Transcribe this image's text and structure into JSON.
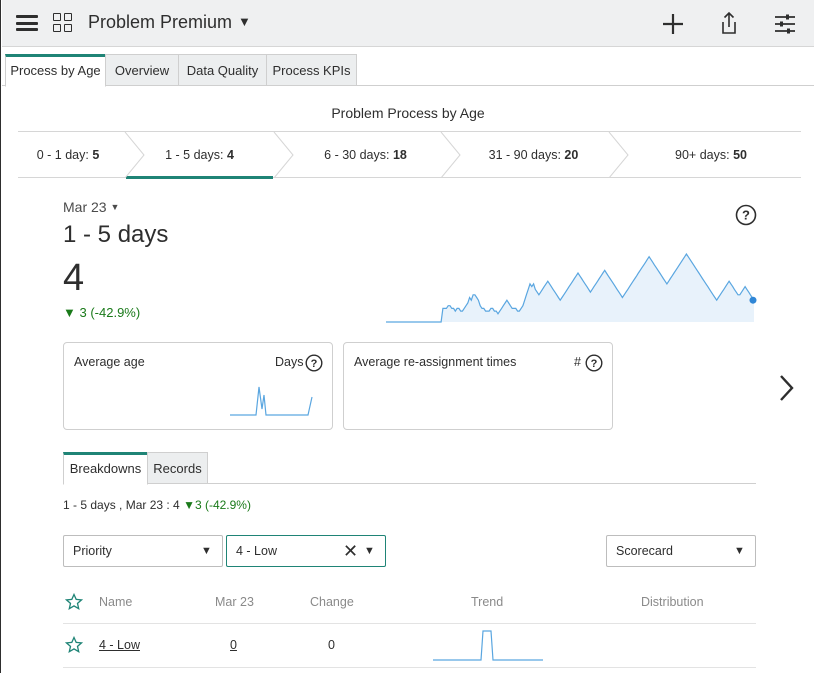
{
  "header": {
    "title": "Problem Premium"
  },
  "tabs": [
    {
      "label": "Process by Age",
      "active": true
    },
    {
      "label": "Overview"
    },
    {
      "label": "Data Quality"
    },
    {
      "label": "Process KPIs"
    }
  ],
  "report": {
    "title": "Problem Process by Age",
    "buckets": [
      {
        "label": "0 - 1 day:",
        "value": "5"
      },
      {
        "label": "1 - 5 days:",
        "value": "4",
        "active": true
      },
      {
        "label": "6 - 30 days:",
        "value": "18"
      },
      {
        "label": "31 - 90 days:",
        "value": "20"
      },
      {
        "label": "90+ days:",
        "value": "50"
      }
    ]
  },
  "score": {
    "date": "Mar 23",
    "range": "1 - 5 days",
    "value": "4",
    "delta": "3 (-42.9%)",
    "trend": [
      0,
      0,
      0,
      0,
      0,
      0,
      0,
      0,
      0,
      0,
      0,
      0,
      0,
      0,
      0,
      0,
      0,
      0,
      0,
      0,
      0,
      0,
      0,
      0,
      0,
      0,
      0,
      0,
      0,
      0,
      0,
      0,
      5,
      5,
      5,
      6,
      6,
      5,
      5,
      4,
      5,
      5,
      4,
      4,
      5,
      6,
      7,
      9,
      8,
      10,
      10,
      9,
      8,
      6,
      5,
      5,
      4,
      4,
      4,
      5,
      5,
      4,
      4,
      3,
      4,
      5,
      6,
      7,
      8,
      7,
      6,
      5,
      5,
      5,
      4,
      4,
      5,
      6,
      8,
      10,
      12,
      14,
      13,
      14,
      12,
      11,
      10,
      11,
      12,
      13,
      14,
      15,
      14,
      13,
      12,
      11,
      10,
      9,
      8,
      9,
      10,
      11,
      12,
      13,
      14,
      15,
      16,
      17,
      18,
      17,
      16,
      15,
      14,
      13,
      12,
      11,
      12,
      13,
      14,
      15,
      16,
      17,
      18,
      19,
      18,
      17,
      16,
      15,
      14,
      13,
      12,
      11,
      10,
      9,
      10,
      11,
      12,
      13,
      14,
      15,
      16,
      17,
      18,
      19,
      20,
      21,
      22,
      23,
      24,
      23,
      22,
      21,
      20,
      19,
      18,
      17,
      16,
      15,
      14,
      15,
      16,
      17,
      18,
      19,
      20,
      21,
      22,
      23,
      24,
      25,
      24,
      23,
      22,
      21,
      20,
      19,
      18,
      17,
      16,
      15,
      14,
      13,
      12,
      11,
      10,
      9,
      8,
      9,
      10,
      11,
      12,
      13,
      14,
      15,
      14,
      13,
      12,
      11,
      10,
      10,
      11,
      12,
      13,
      12,
      11,
      10,
      9,
      8
    ]
  },
  "cards": [
    {
      "title": "Average age",
      "unit": "Days"
    },
    {
      "title": "Average re-assignment times",
      "unit": "#"
    }
  ],
  "subtabs": [
    {
      "label": "Breakdowns",
      "active": true
    },
    {
      "label": "Records"
    }
  ],
  "summary": {
    "text": "1 - 5 days , Mar 23 : 4",
    "delta": "3 (-42.9%)"
  },
  "filters": {
    "breakdown": "Priority",
    "element": "4 - Low",
    "view": "Scorecard"
  },
  "table": {
    "columns": [
      "Name",
      "Mar 23",
      "Change",
      "Trend",
      "Distribution"
    ],
    "rows": [
      {
        "name": "4 - Low",
        "value": "0",
        "change": "0"
      }
    ]
  },
  "colors": {
    "accent": "#1f8476",
    "positive": "#1a7a1a",
    "spark": "#5aa6e0"
  }
}
